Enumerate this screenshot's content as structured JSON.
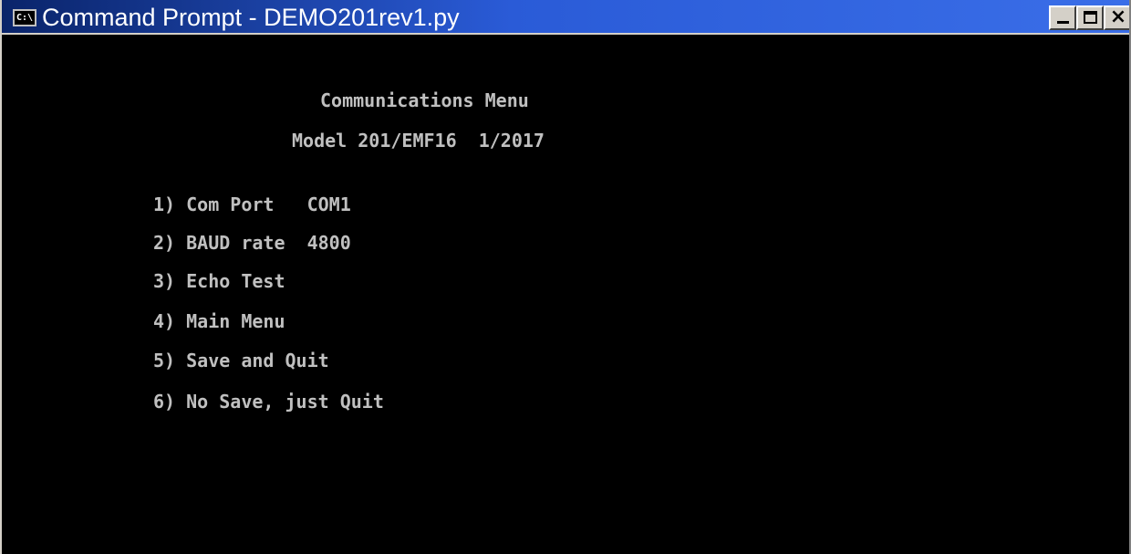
{
  "window": {
    "title": "Command Prompt - DEMO201rev1.py",
    "icon_label": "C:\\"
  },
  "console": {
    "heading": "Communications Menu",
    "subheading": "Model 201/EMF16  1/2017",
    "menu_items": [
      "1) Com Port   COM1",
      "2) BAUD rate  4800",
      "3) Echo Test",
      "4) Main Menu",
      "5) Save and Quit",
      "6) No Save, just Quit"
    ]
  },
  "colors": {
    "title_bar": "#0a246a",
    "console_background": "#000000",
    "console_text": "#c0c0c0"
  }
}
